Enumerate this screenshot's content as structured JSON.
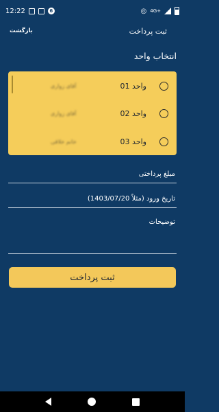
{
  "status_bar": {
    "time": "12:22",
    "network": "4G+"
  },
  "header": {
    "back_label": "بازگشت",
    "title": "ثبت پرداخت"
  },
  "unit_section": {
    "title": "انتخاب واحد",
    "units": [
      {
        "label": "واحد 01",
        "owner": "آقای زواری"
      },
      {
        "label": "واحد 02",
        "owner": "آقای زواری"
      },
      {
        "label": "واحد 03",
        "owner": "خانم خلاقی"
      }
    ]
  },
  "form": {
    "amount_label": "مبلغ پرداختی",
    "date_label": "تاریخ ورود (مثلاً 1403/07/20)",
    "description_label": "توضیحات"
  },
  "submit_label": "ثبت پرداخت",
  "colors": {
    "background": "#0f3a64",
    "accent": "#f5cd5a"
  }
}
